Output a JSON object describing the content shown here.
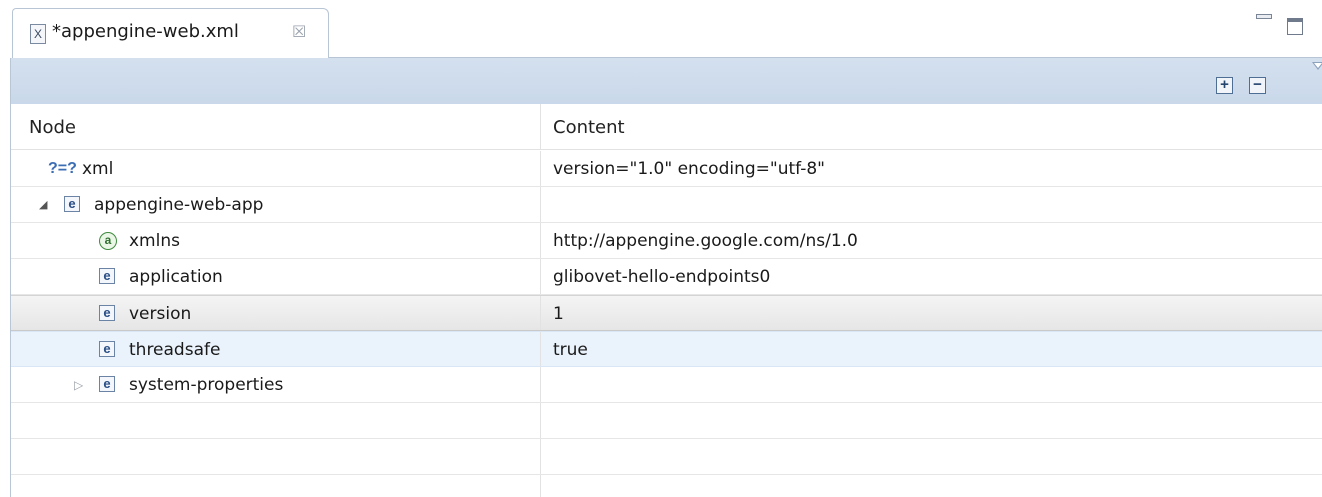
{
  "editor": {
    "tab_title": "*appengine-web.xml",
    "tab_icon_glyph": "X",
    "tab_close_glyph": "☒"
  },
  "toolbar": {
    "expand_glyph": "+",
    "collapse_glyph": "−"
  },
  "table": {
    "columns": [
      "Node",
      "Content"
    ],
    "rows": [
      {
        "icon": "processing-instruction-icon",
        "glyph": "?=?",
        "node": "xml",
        "content": "version=\"1.0\" encoding=\"utf-8\"",
        "depth": 0,
        "twisty": "none"
      },
      {
        "icon": "element-icon",
        "glyph": "e",
        "node": "appengine-web-app",
        "content": "",
        "depth": 0,
        "twisty": "expanded"
      },
      {
        "icon": "attribute-icon",
        "glyph": "a",
        "node": "xmlns",
        "content": "http://appengine.google.com/ns/1.0",
        "depth": 1,
        "twisty": "none"
      },
      {
        "icon": "element-icon",
        "glyph": "e",
        "node": "application",
        "content": "glibovet-hello-endpoints0",
        "depth": 1,
        "twisty": "none"
      },
      {
        "icon": "element-icon",
        "glyph": "e",
        "node": "version",
        "content": "1",
        "depth": 1,
        "twisty": "none",
        "state": "selected"
      },
      {
        "icon": "element-icon",
        "glyph": "e",
        "node": "threadsafe",
        "content": "true",
        "depth": 1,
        "twisty": "none",
        "state": "hover"
      },
      {
        "icon": "element-icon",
        "glyph": "e",
        "node": "system-properties",
        "content": "",
        "depth": 1,
        "twisty": "collapsed"
      }
    ],
    "twisty_glyphs": {
      "expanded": "◢",
      "collapsed": "▷"
    }
  }
}
